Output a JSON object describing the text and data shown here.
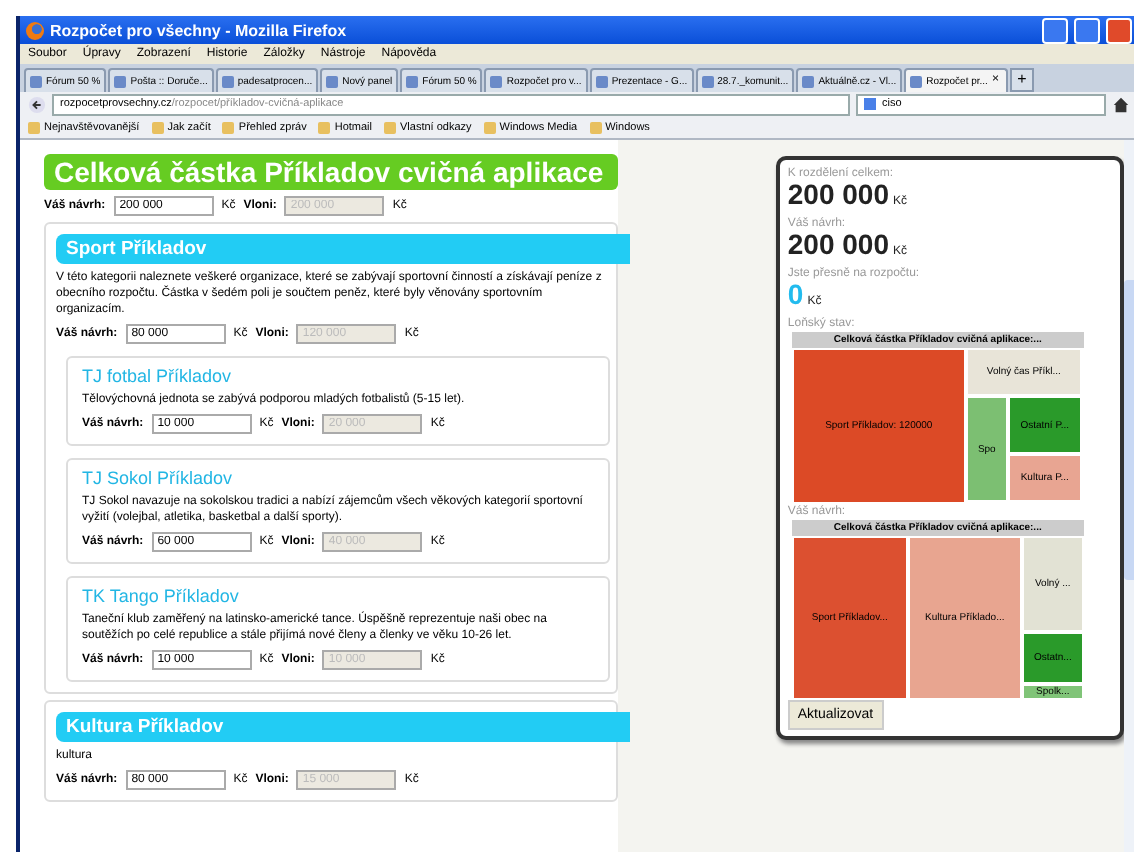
{
  "window": {
    "title": "Rozpočet pro všechny - Mozilla Firefox"
  },
  "menu": [
    "Soubor",
    "Úpravy",
    "Zobrazení",
    "Historie",
    "Záložky",
    "Nástroje",
    "Nápověda"
  ],
  "tabs": [
    {
      "label": "Fórum 50 %",
      "selected": false
    },
    {
      "label": "Pošta :: Doruče...",
      "selected": false
    },
    {
      "label": "padesatprocen...",
      "selected": false
    },
    {
      "label": "Nový panel",
      "selected": false
    },
    {
      "label": "Fórum 50 %",
      "selected": false
    },
    {
      "label": "Rozpočet pro v...",
      "selected": false
    },
    {
      "label": "Prezentace - G...",
      "selected": false
    },
    {
      "label": "28.7._komunit...",
      "selected": false
    },
    {
      "label": "Aktuálně.cz - Vl...",
      "selected": false
    },
    {
      "label": "Rozpočet pr...",
      "selected": true,
      "close": "×"
    }
  ],
  "new_tab": "+",
  "address": {
    "host": "rozpocetprovsechny.cz",
    "path": "/rozpocet/příkladov-cvičná-aplikace"
  },
  "search": {
    "value": "ciso"
  },
  "bookmarks": [
    "Nejnavštěvovanější",
    "Jak začít",
    "Přehled zpráv",
    "Hotmail",
    "Vlastní odkazy",
    "Windows Media",
    "Windows"
  ],
  "page": {
    "title": "Celková částka Příkladov cvičná aplikace",
    "proposal": {
      "label": "Váš návrh:",
      "value": "200 000",
      "unit": "Kč",
      "last_label": "Vloni:",
      "last_value": "200 000",
      "last_unit": "Kč"
    },
    "categories": [
      {
        "title": "Sport Příkladov",
        "description": "V této kategorii naleznete veškeré organizace, které se zabývají sportovní činností a získávají peníze z obecního rozpočtu. Částka v šedém poli je součtem peněz, které byly věnovány sportovním organizacím.",
        "proposal": {
          "label": "Váš návrh:",
          "value": "80 000",
          "unit": "Kč",
          "last_label": "Vloni:",
          "last_value": "120 000",
          "last_unit": "Kč"
        },
        "organizations": [
          {
            "title": "TJ fotbal Příkladov",
            "description": "Tělovýchovná jednota se zabývá podporou mladých fotbalistů (5-15 let).",
            "proposal": {
              "label": "Váš návrh:",
              "value": "10 000",
              "unit": "Kč",
              "last_label": "Vloni:",
              "last_value": "20 000",
              "last_unit": "Kč"
            }
          },
          {
            "title": "TJ Sokol Příkladov",
            "description": "TJ Sokol navazuje na sokolskou tradici a nabízí zájemcům všech věkových kategorií sportovní vyžití (volejbal, atletika, basketbal a další sporty).",
            "proposal": {
              "label": "Váš návrh:",
              "value": "60 000",
              "unit": "Kč",
              "last_label": "Vloni:",
              "last_value": "40 000",
              "last_unit": "Kč"
            }
          },
          {
            "title": "TK Tango Příkladov",
            "description": "Taneční klub zaměřený na latinsko-americké tance. Úspěšně reprezentuje naši obec na soutěžích po celé republice a stále přijímá nové členy a členky ve věku 10-26 let.",
            "proposal": {
              "label": "Váš návrh:",
              "value": "10 000",
              "unit": "Kč",
              "last_label": "Vloni:",
              "last_value": "10 000",
              "last_unit": "Kč"
            }
          }
        ]
      },
      {
        "title": "Kultura Příkladov",
        "description": "kultura",
        "proposal": {
          "label": "Váš návrh:",
          "value": "80 000",
          "unit": "Kč",
          "last_label": "Vloni:",
          "last_value": "15 000",
          "last_unit": "Kč"
        }
      }
    ]
  },
  "summary": {
    "total_label": "K rozdělení celkem:",
    "total": "200 000",
    "total_unit": "Kč",
    "proposal_label": "Váš návrh:",
    "proposal": "200 000",
    "proposal_unit": "Kč",
    "balance_label": "Jste přesně na rozpočtu:",
    "balance": "0",
    "balance_unit": "Kč",
    "treemaps": [
      {
        "label": "Loňský stav:",
        "header": "Celková částka Příkladov cvičná aplikace:...",
        "cells": [
          {
            "label": "Sport Příkladov: 120000",
            "color": "#dc4a26"
          },
          {
            "label": "Volný čas Příkl...",
            "color": "#e8e4d8"
          },
          {
            "label": "Spo",
            "color": "#7cbf72"
          },
          {
            "label": "Ostatní P...",
            "color": "#2a9a2a"
          },
          {
            "label": "Kultura P...",
            "color": "#e8a592"
          }
        ]
      },
      {
        "label": "Váš návrh:",
        "header": "Celková částka Příkladov cvičná aplikace:...",
        "cells": [
          {
            "label": "Sport Příkladov...",
            "color": "#dc5030"
          },
          {
            "label": "Kultura Příklado...",
            "color": "#e8a590"
          },
          {
            "label": "Volný ...",
            "color": "#e2e2d4"
          },
          {
            "label": "Ostatn...",
            "color": "#2a9a2a"
          },
          {
            "label": "Spolk...",
            "color": "#80c478"
          }
        ]
      }
    ],
    "button": "Aktualizovat"
  }
}
